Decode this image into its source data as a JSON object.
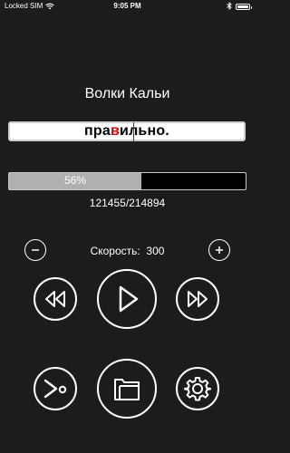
{
  "status_bar": {
    "carrier": "Locked SIM",
    "time": "9:05 PM",
    "icons": [
      "wifi-icon",
      "bluetooth-icon",
      "battery-icon"
    ]
  },
  "reader": {
    "title": "Волки Кальи",
    "word_before": "пра",
    "word_focus": "в",
    "word_after": "ильно.",
    "focus_color": "#e00000"
  },
  "progress": {
    "percent": 56,
    "label": "56%",
    "counter": "121455/214894"
  },
  "speed": {
    "label": "Скорость:",
    "value": "300"
  },
  "controls": {
    "icons": [
      "minus-icon",
      "plus-icon",
      "rewind-icon",
      "play-icon",
      "fast-forward-icon",
      "share-icon",
      "folder-icon",
      "gear-icon"
    ]
  }
}
